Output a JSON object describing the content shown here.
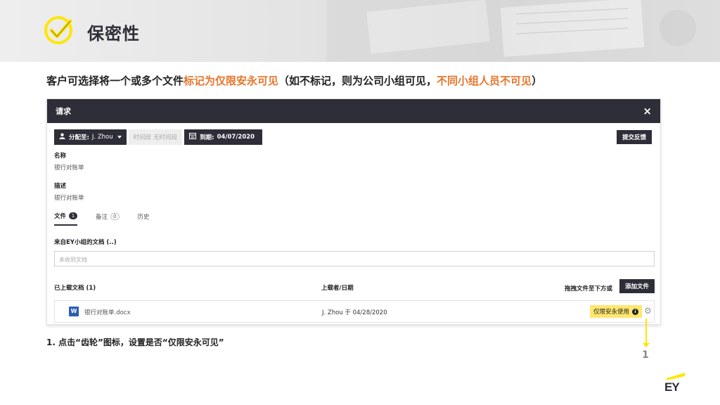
{
  "slide": {
    "title": "保密性",
    "subtitle_parts": [
      {
        "text": "客户可选择将一个或多个文件",
        "highlight": false
      },
      {
        "text": "标记为仅限安永可见",
        "highlight": true
      },
      {
        "text": "（如不标记，则为公司小组可见，",
        "highlight": false
      },
      {
        "text": "不同小组人员不可见",
        "highlight": true
      },
      {
        "text": "）",
        "highlight": false
      }
    ],
    "step_note": "1. 点击“齿轮”图标，设置是否“仅限安永可见”",
    "callout_number": "1",
    "highlight_color": "#e8742a",
    "accent_yellow": "#ffe600",
    "dark_color": "#2e2e38"
  },
  "dialog": {
    "title": "请求",
    "close_icon": "×",
    "assign_label": "分配至:",
    "assign_value": "J. Zhou",
    "period_label": "时间段",
    "period_value": "无时间段",
    "due_label": "到期:",
    "due_value": "04/07/2020",
    "feedback_button": "提交反馈",
    "name_label": "名称",
    "name_value": "银行对账单",
    "desc_label": "描述",
    "desc_value": "银行对账单",
    "tabs": [
      {
        "label": "文件",
        "count": "1"
      },
      {
        "label": "备注",
        "count": "0"
      },
      {
        "label": "历史",
        "count": ""
      }
    ],
    "ey_docs_label": "来自EY小组的文档 (..)",
    "ey_docs_placeholder": "未收到文档",
    "uploaded_label": "已上载文档 (1)",
    "uploader_col": "上载者/日期",
    "drag_text": "拖拽文件至下方或",
    "add_file_button": "添加文件",
    "file": {
      "name": "银行对账单.docx",
      "icon_letter": "W",
      "uploader": "J. Zhou 于 04/28/2020",
      "ey_only_label": "仅限安永使用",
      "info_glyph": "i",
      "gear_glyph": "⚙"
    }
  },
  "brand": {
    "logo_text": "EY"
  }
}
